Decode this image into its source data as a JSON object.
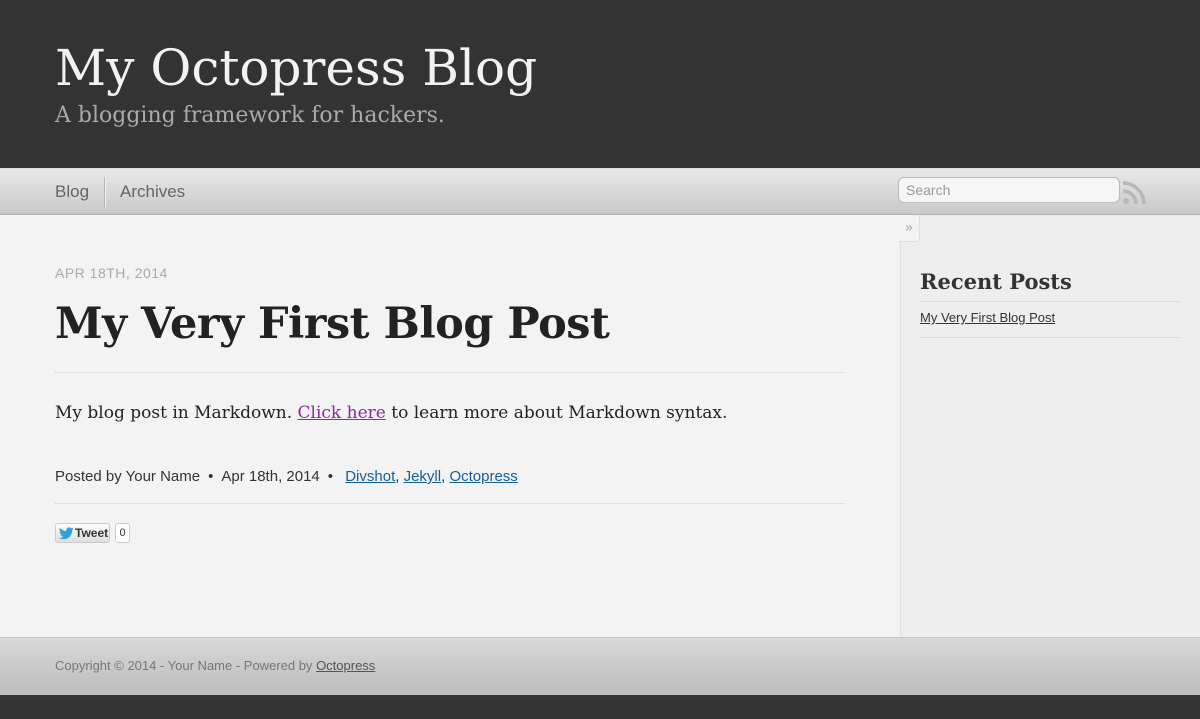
{
  "header": {
    "title": "My Octopress Blog",
    "subtitle": "A blogging framework for hackers."
  },
  "nav": {
    "items": [
      {
        "label": "Blog"
      },
      {
        "label": "Archives"
      }
    ],
    "search_placeholder": "Search",
    "rss_icon": "rss-icon"
  },
  "post": {
    "date": "APR 18TH, 2014",
    "title": "My Very First Blog Post",
    "body_before": "My blog post in Markdown. ",
    "body_link": "Click here",
    "body_after": " to learn more about Markdown syntax.",
    "meta_author": "Posted by Your Name",
    "meta_date": "Apr 18th, 2014",
    "categories": [
      "Divshot",
      "Jekyll",
      "Octopress"
    ],
    "tweet_label": "Tweet",
    "tweet_count": "0"
  },
  "sidebar": {
    "collapse_icon": "»",
    "heading": "Recent Posts",
    "recent_posts": [
      "My Very First Blog Post"
    ]
  },
  "footer": {
    "text": "Copyright © 2014 - Your Name - Powered by ",
    "link": "Octopress"
  },
  "colors": {
    "header_bg": "#333333",
    "link_visited": "#8a2b9a",
    "category_link": "#125e9a"
  }
}
